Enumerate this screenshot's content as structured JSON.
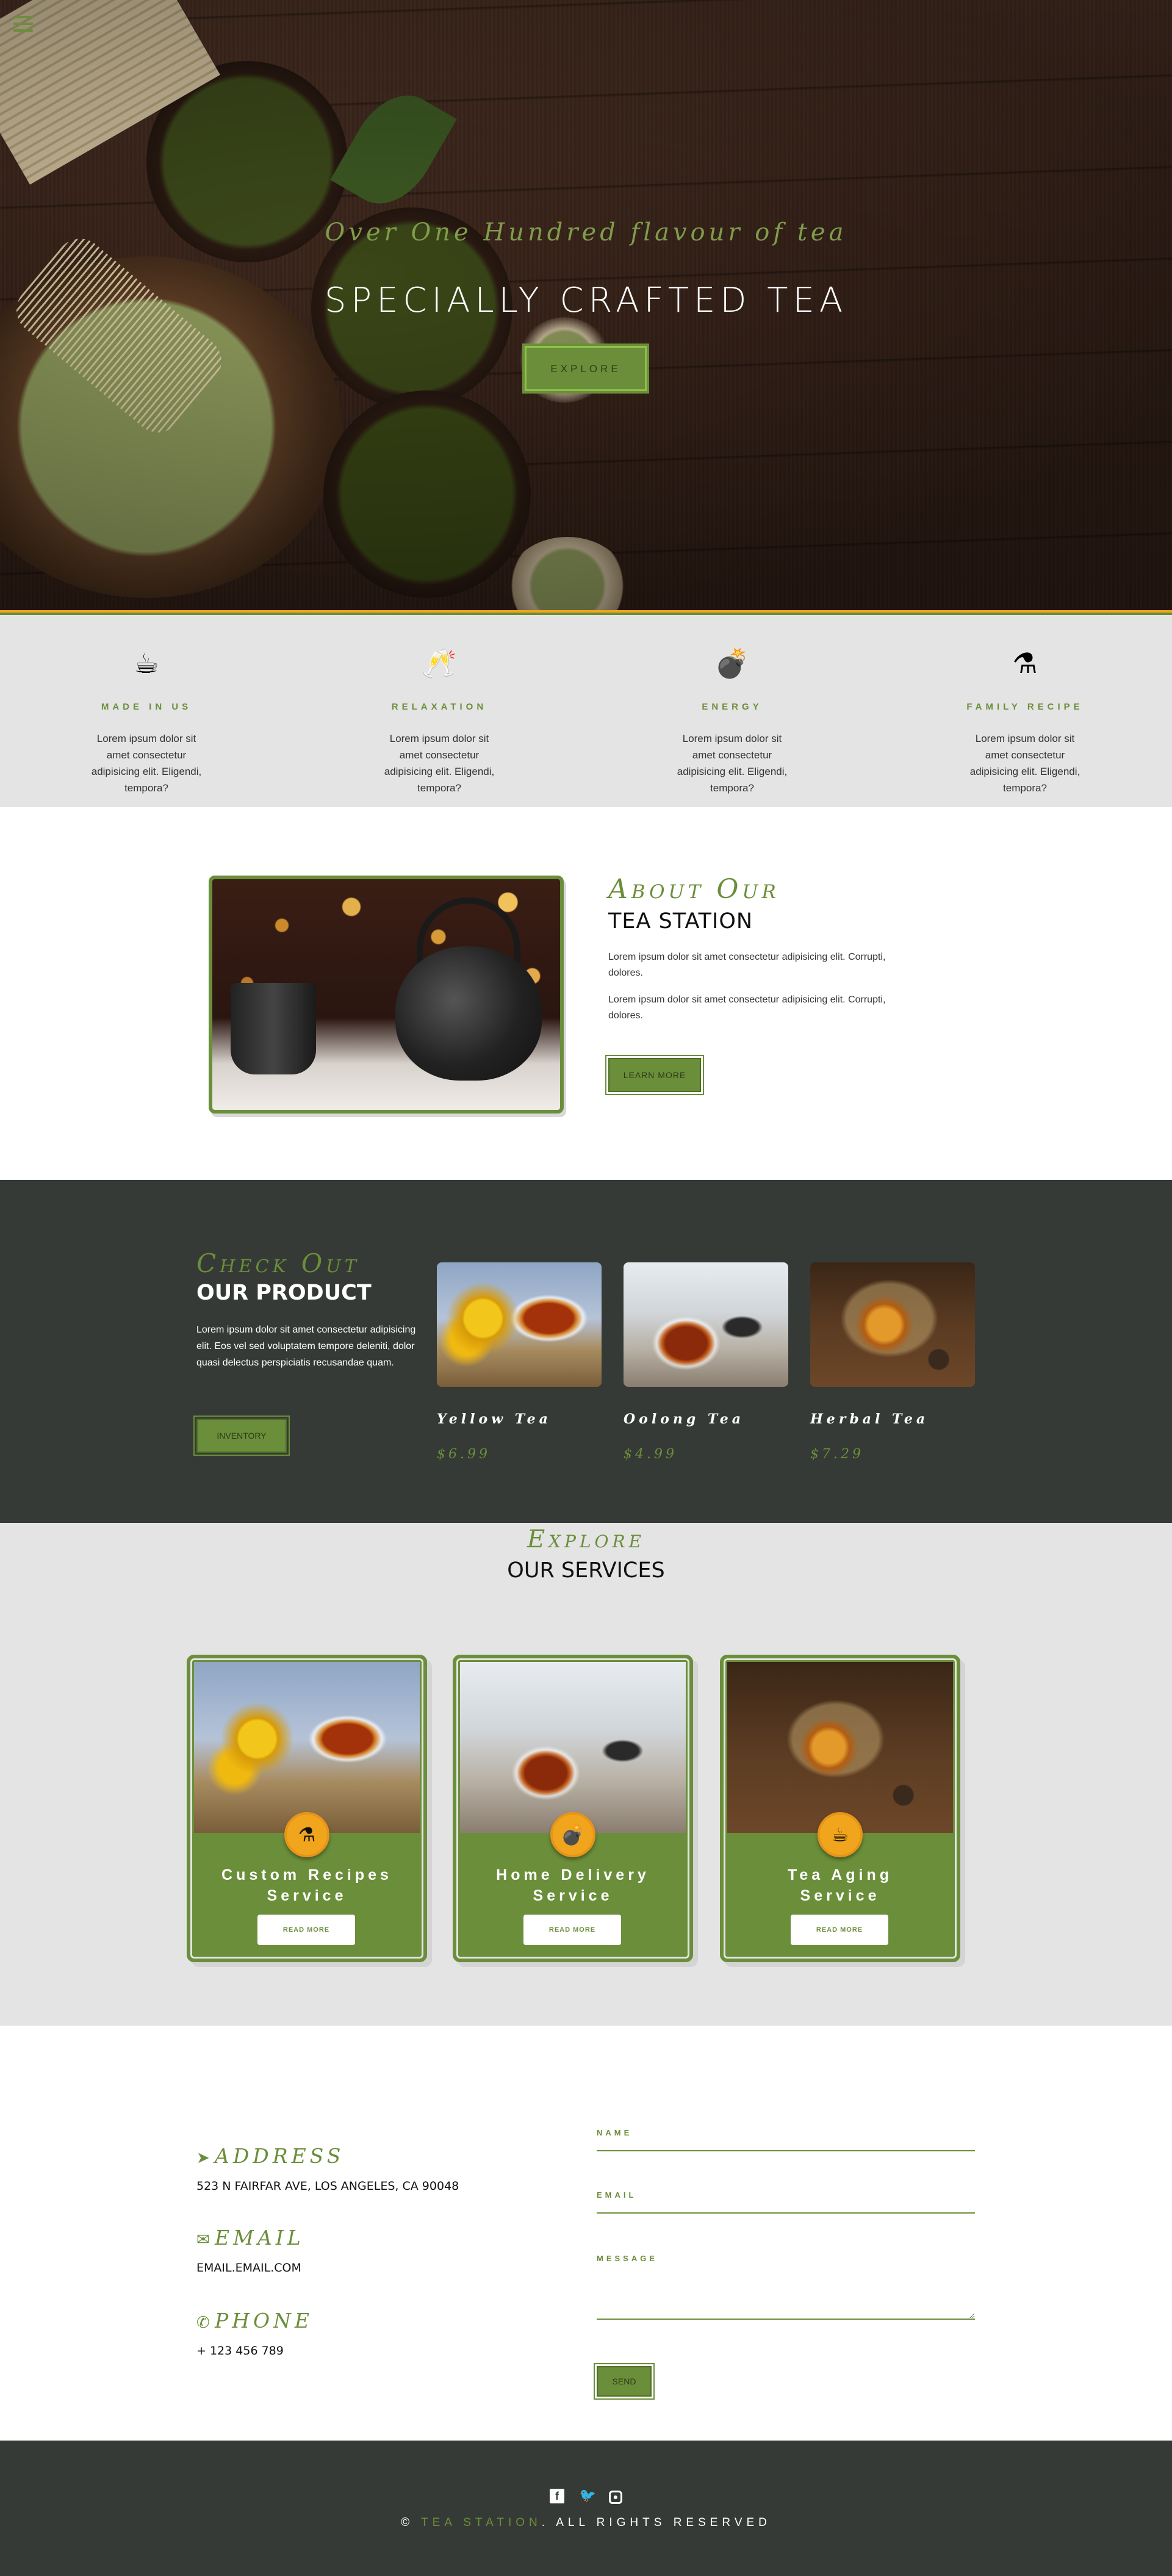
{
  "hero": {
    "subtitle": "Over One Hundred flavour of tea",
    "title": "SPECIALLY CRAFTED TEA",
    "button": "EXPLORE"
  },
  "features": [
    {
      "icon": "coffee-cup-icon",
      "glyph": "☕",
      "title": "MADE IN US",
      "text": "Lorem ipsum dolor sit amet consectetur adipisicing elit. Eligendi, tempora?"
    },
    {
      "icon": "cheers-glasses-icon",
      "glyph": "🥂",
      "title": "RELAXATION",
      "text": "Lorem ipsum dolor sit amet consectetur adipisicing elit. Eligendi, tempora?"
    },
    {
      "icon": "bomb-icon",
      "glyph": "💣",
      "title": "ENERGY",
      "text": "Lorem ipsum dolor sit amet consectetur adipisicing elit. Eligendi, tempora?"
    },
    {
      "icon": "mortar-pestle-icon",
      "glyph": "⚗",
      "title": "FAMILY RECIPE",
      "text": "Lorem ipsum dolor sit amet consectetur adipisicing elit. Eligendi, tempora?"
    }
  ],
  "about": {
    "heading1": "About Our",
    "heading2": "TEA STATION",
    "paragraphs": [
      "Lorem ipsum dolor sit amet consectetur adipisicing elit. Corrupti, dolores.",
      "Lorem ipsum dolor sit amet consectetur adipisicing elit. Corrupti, dolores."
    ],
    "button": "LEARN MORE"
  },
  "product": {
    "heading1": "Check Out",
    "heading2": "OUR PRODUCT",
    "text": "Lorem ipsum dolor sit amet consectetur adipisicing elit. Eos vel sed voluptatem tempore deleniti, dolor quasi delectus perspiciatis recusandae quam.",
    "button": "INVENTORY",
    "items": [
      {
        "name": "Yellow Tea",
        "price": "$6.99"
      },
      {
        "name": "Oolong Tea",
        "price": "$4.99"
      },
      {
        "name": "Herbal Tea",
        "price": "$7.29"
      }
    ]
  },
  "services": {
    "heading1": "Explore",
    "heading2": "OUR SERVICES",
    "items": [
      {
        "title_line1": "Custom Recipes",
        "title_line2": "Service",
        "button": "READ MORE",
        "icon": "mortar-pestle-icon",
        "glyph": "⚗"
      },
      {
        "title_line1": "Home Delivery",
        "title_line2": "Service",
        "button": "READ MORE",
        "icon": "bomb-icon",
        "glyph": "💣"
      },
      {
        "title_line1": "Tea Aging",
        "title_line2": "Service",
        "button": "READ MORE",
        "icon": "coffee-cup-icon",
        "glyph": "☕"
      }
    ]
  },
  "contact": {
    "address_label": "ADDRESS",
    "address": "523 N FAIRFAR AVE, LOS ANGELES, CA 90048",
    "email_label": "EMAIL",
    "email": "EMAIL.EMAIL.COM",
    "phone_label": "PHONE",
    "phone": "+ 123 456 789",
    "form": {
      "name_label": "NAME",
      "email_label": "EMAIL",
      "message_label": "MESSAGE",
      "send": "SEND"
    }
  },
  "footer": {
    "copyright_symbol": "©",
    "brand": "TEA STATION",
    "rights": ". ALL RIGHTS RESERVED"
  },
  "colors": {
    "accent": "#6b8e3a",
    "orange": "#f0a51c",
    "dark": "#363a36",
    "light_gray": "#e4e4e4"
  }
}
